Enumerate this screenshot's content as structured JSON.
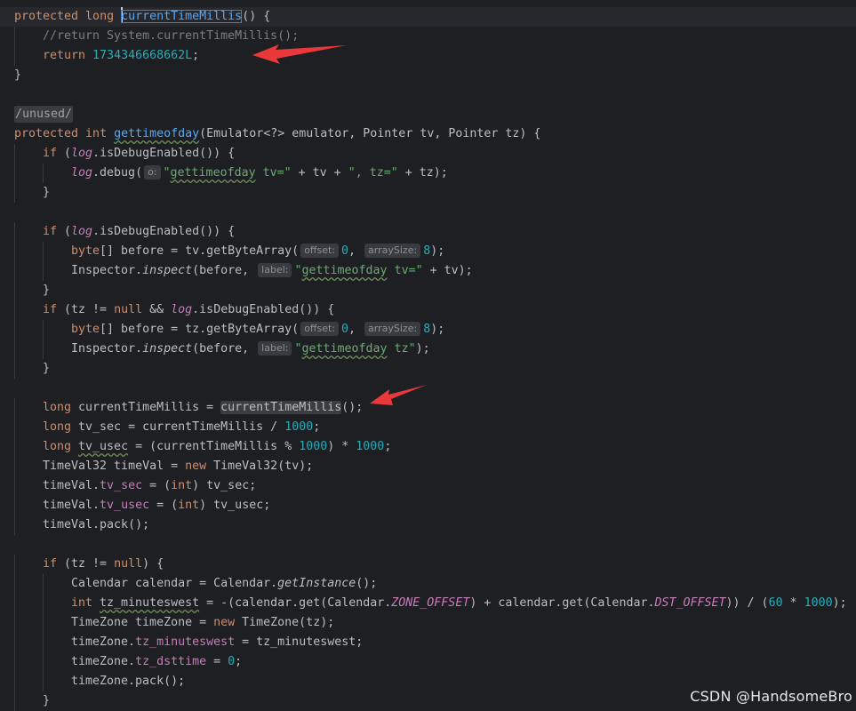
{
  "code": {
    "lines": [
      {
        "indent": 0,
        "current": true,
        "tokens": [
          {
            "t": "protected long ",
            "c": "kw"
          },
          {
            "t": "currentTimeMillis",
            "c": "fn",
            "cls": "cursel",
            "caret": true
          },
          {
            "t": "() {"
          }
        ]
      },
      {
        "indent": 1,
        "tokens": [
          {
            "t": "//return System.currentTimeMillis();",
            "c": "cmt"
          }
        ]
      },
      {
        "indent": 1,
        "tokens": [
          {
            "t": "return ",
            "c": "kw"
          },
          {
            "t": "1734346668662L",
            "c": "num"
          },
          {
            "t": ";"
          }
        ]
      },
      {
        "indent": 0,
        "tokens": [
          {
            "t": "}"
          }
        ]
      },
      {
        "indent": 0,
        "tokens": []
      },
      {
        "indent": 0,
        "tokens": [
          {
            "t": "/unused/",
            "c": "unused"
          }
        ]
      },
      {
        "indent": 0,
        "tokens": [
          {
            "t": "protected int ",
            "c": "kw"
          },
          {
            "t": "gettimeofday",
            "c": "fn",
            "cls": "wavy"
          },
          {
            "t": "(Emulator<?> emulator, Pointer tv, Pointer tz) {"
          }
        ]
      },
      {
        "indent": 1,
        "tokens": [
          {
            "t": "if ",
            "c": "kw"
          },
          {
            "t": "("
          },
          {
            "t": "log",
            "c": "logv"
          },
          {
            "t": ".isDebugEnabled()) {"
          }
        ]
      },
      {
        "indent": 2,
        "tokens": [
          {
            "t": "log",
            "c": "logv"
          },
          {
            "t": ".debug("
          },
          {
            "hint": "o:"
          },
          {
            "t": "\"",
            "c": "str"
          },
          {
            "t": "gettimeofday",
            "c": "str",
            "cls": "wavy"
          },
          {
            "t": " tv=\"",
            "c": "str"
          },
          {
            "t": " + tv + "
          },
          {
            "t": "\", tz=\"",
            "c": "str"
          },
          {
            "t": " + tz);"
          }
        ]
      },
      {
        "indent": 1,
        "tokens": [
          {
            "t": "}"
          }
        ]
      },
      {
        "indent": 0,
        "tokens": []
      },
      {
        "indent": 1,
        "tokens": [
          {
            "t": "if ",
            "c": "kw"
          },
          {
            "t": "("
          },
          {
            "t": "log",
            "c": "logv"
          },
          {
            "t": ".isDebugEnabled()) {"
          }
        ]
      },
      {
        "indent": 2,
        "tokens": [
          {
            "t": "byte",
            "c": "kw"
          },
          {
            "t": "[] before = tv.getByteArray("
          },
          {
            "hint": "offset:"
          },
          {
            "t": "0",
            "c": "num"
          },
          {
            "t": ", "
          },
          {
            "hint": "arraySize:"
          },
          {
            "t": "8",
            "c": "num"
          },
          {
            "t": ");"
          }
        ]
      },
      {
        "indent": 2,
        "tokens": [
          {
            "t": "Inspector."
          },
          {
            "t": "inspect",
            "c": "ital"
          },
          {
            "t": "(before, "
          },
          {
            "hint": "label:"
          },
          {
            "t": "\"",
            "c": "str"
          },
          {
            "t": "gettimeofday",
            "c": "str",
            "cls": "wavy"
          },
          {
            "t": " tv=\"",
            "c": "str"
          },
          {
            "t": " + tv);"
          }
        ]
      },
      {
        "indent": 1,
        "tokens": [
          {
            "t": "}"
          }
        ]
      },
      {
        "indent": 1,
        "tokens": [
          {
            "t": "if ",
            "c": "kw"
          },
          {
            "t": "(tz != "
          },
          {
            "t": "null",
            "c": "kw"
          },
          {
            "t": " && "
          },
          {
            "t": "log",
            "c": "logv"
          },
          {
            "t": ".isDebugEnabled()) {"
          }
        ]
      },
      {
        "indent": 2,
        "tokens": [
          {
            "t": "byte",
            "c": "kw"
          },
          {
            "t": "[] before = tz.getByteArray("
          },
          {
            "hint": "offset:"
          },
          {
            "t": "0",
            "c": "num"
          },
          {
            "t": ", "
          },
          {
            "hint": "arraySize:"
          },
          {
            "t": "8",
            "c": "num"
          },
          {
            "t": ");"
          }
        ]
      },
      {
        "indent": 2,
        "tokens": [
          {
            "t": "Inspector."
          },
          {
            "t": "inspect",
            "c": "ital"
          },
          {
            "t": "(before, "
          },
          {
            "hint": "label:"
          },
          {
            "t": "\"",
            "c": "str"
          },
          {
            "t": "gettimeofday",
            "c": "str",
            "cls": "wavy"
          },
          {
            "t": " tz\"",
            "c": "str"
          },
          {
            "t": ");"
          }
        ]
      },
      {
        "indent": 1,
        "tokens": [
          {
            "t": "}"
          }
        ]
      },
      {
        "indent": 0,
        "tokens": []
      },
      {
        "indent": 1,
        "tokens": [
          {
            "t": "long ",
            "c": "kw"
          },
          {
            "t": "currentTimeMillis = "
          },
          {
            "t": "currentTimeMillis",
            "cls": "hl"
          },
          {
            "t": "();"
          }
        ]
      },
      {
        "indent": 1,
        "tokens": [
          {
            "t": "long ",
            "c": "kw"
          },
          {
            "t": "tv_sec = currentTimeMillis / "
          },
          {
            "t": "1000",
            "c": "num"
          },
          {
            "t": ";"
          }
        ]
      },
      {
        "indent": 1,
        "tokens": [
          {
            "t": "long ",
            "c": "kw"
          },
          {
            "t": "tv_usec",
            "cls": "wavy"
          },
          {
            "t": " = (currentTimeMillis % "
          },
          {
            "t": "1000",
            "c": "num"
          },
          {
            "t": ") * "
          },
          {
            "t": "1000",
            "c": "num"
          },
          {
            "t": ";"
          }
        ]
      },
      {
        "indent": 1,
        "tokens": [
          {
            "t": "TimeVal32 timeVal = "
          },
          {
            "t": "new ",
            "c": "kw"
          },
          {
            "t": "TimeVal32(tv);"
          }
        ]
      },
      {
        "indent": 1,
        "tokens": [
          {
            "t": "timeVal."
          },
          {
            "t": "tv_sec",
            "c": "fld"
          },
          {
            "t": " = ("
          },
          {
            "t": "int",
            "c": "kw"
          },
          {
            "t": ") tv_sec;"
          }
        ]
      },
      {
        "indent": 1,
        "tokens": [
          {
            "t": "timeVal."
          },
          {
            "t": "tv_usec",
            "c": "fld"
          },
          {
            "t": " = ("
          },
          {
            "t": "int",
            "c": "kw"
          },
          {
            "t": ") tv_usec;"
          }
        ]
      },
      {
        "indent": 1,
        "tokens": [
          {
            "t": "timeVal.pack();"
          }
        ]
      },
      {
        "indent": 0,
        "tokens": []
      },
      {
        "indent": 1,
        "tokens": [
          {
            "t": "if ",
            "c": "kw"
          },
          {
            "t": "(tz != "
          },
          {
            "t": "null",
            "c": "kw"
          },
          {
            "t": ") {"
          }
        ]
      },
      {
        "indent": 2,
        "tokens": [
          {
            "t": "Calendar calendar = Calendar."
          },
          {
            "t": "getInstance",
            "c": "ital"
          },
          {
            "t": "();"
          }
        ]
      },
      {
        "indent": 2,
        "tokens": [
          {
            "t": "int ",
            "c": "kw"
          },
          {
            "t": "tz_minuteswest",
            "cls": "wavy"
          },
          {
            "t": " = -(calendar.get(Calendar."
          },
          {
            "t": "ZONE_OFFSET",
            "c": "fld ital"
          },
          {
            "t": ") + calendar.get(Calendar."
          },
          {
            "t": "DST_OFFSET",
            "c": "fld ital"
          },
          {
            "t": ")) / ("
          },
          {
            "t": "60",
            "c": "num"
          },
          {
            "t": " * "
          },
          {
            "t": "1000",
            "c": "num"
          },
          {
            "t": ");"
          }
        ]
      },
      {
        "indent": 2,
        "tokens": [
          {
            "t": "TimeZone timeZone = "
          },
          {
            "t": "new ",
            "c": "kw"
          },
          {
            "t": "TimeZone(tz);"
          }
        ]
      },
      {
        "indent": 2,
        "tokens": [
          {
            "t": "timeZone."
          },
          {
            "t": "tz_minuteswest",
            "c": "fld"
          },
          {
            "t": " = tz_minuteswest;"
          }
        ]
      },
      {
        "indent": 2,
        "tokens": [
          {
            "t": "timeZone."
          },
          {
            "t": "tz_dsttime",
            "c": "fld"
          },
          {
            "t": " = "
          },
          {
            "t": "0",
            "c": "num"
          },
          {
            "t": ";"
          }
        ]
      },
      {
        "indent": 2,
        "tokens": [
          {
            "t": "timeZone.pack();"
          }
        ]
      },
      {
        "indent": 1,
        "tokens": [
          {
            "t": "}"
          }
        ]
      }
    ]
  },
  "annotations": {
    "arrow_color": "#e8383a",
    "arrows": [
      "arrow-to-return-value",
      "arrow-to-currentTimeMillis-call"
    ]
  },
  "watermark": "CSDN @HandsomeBro"
}
